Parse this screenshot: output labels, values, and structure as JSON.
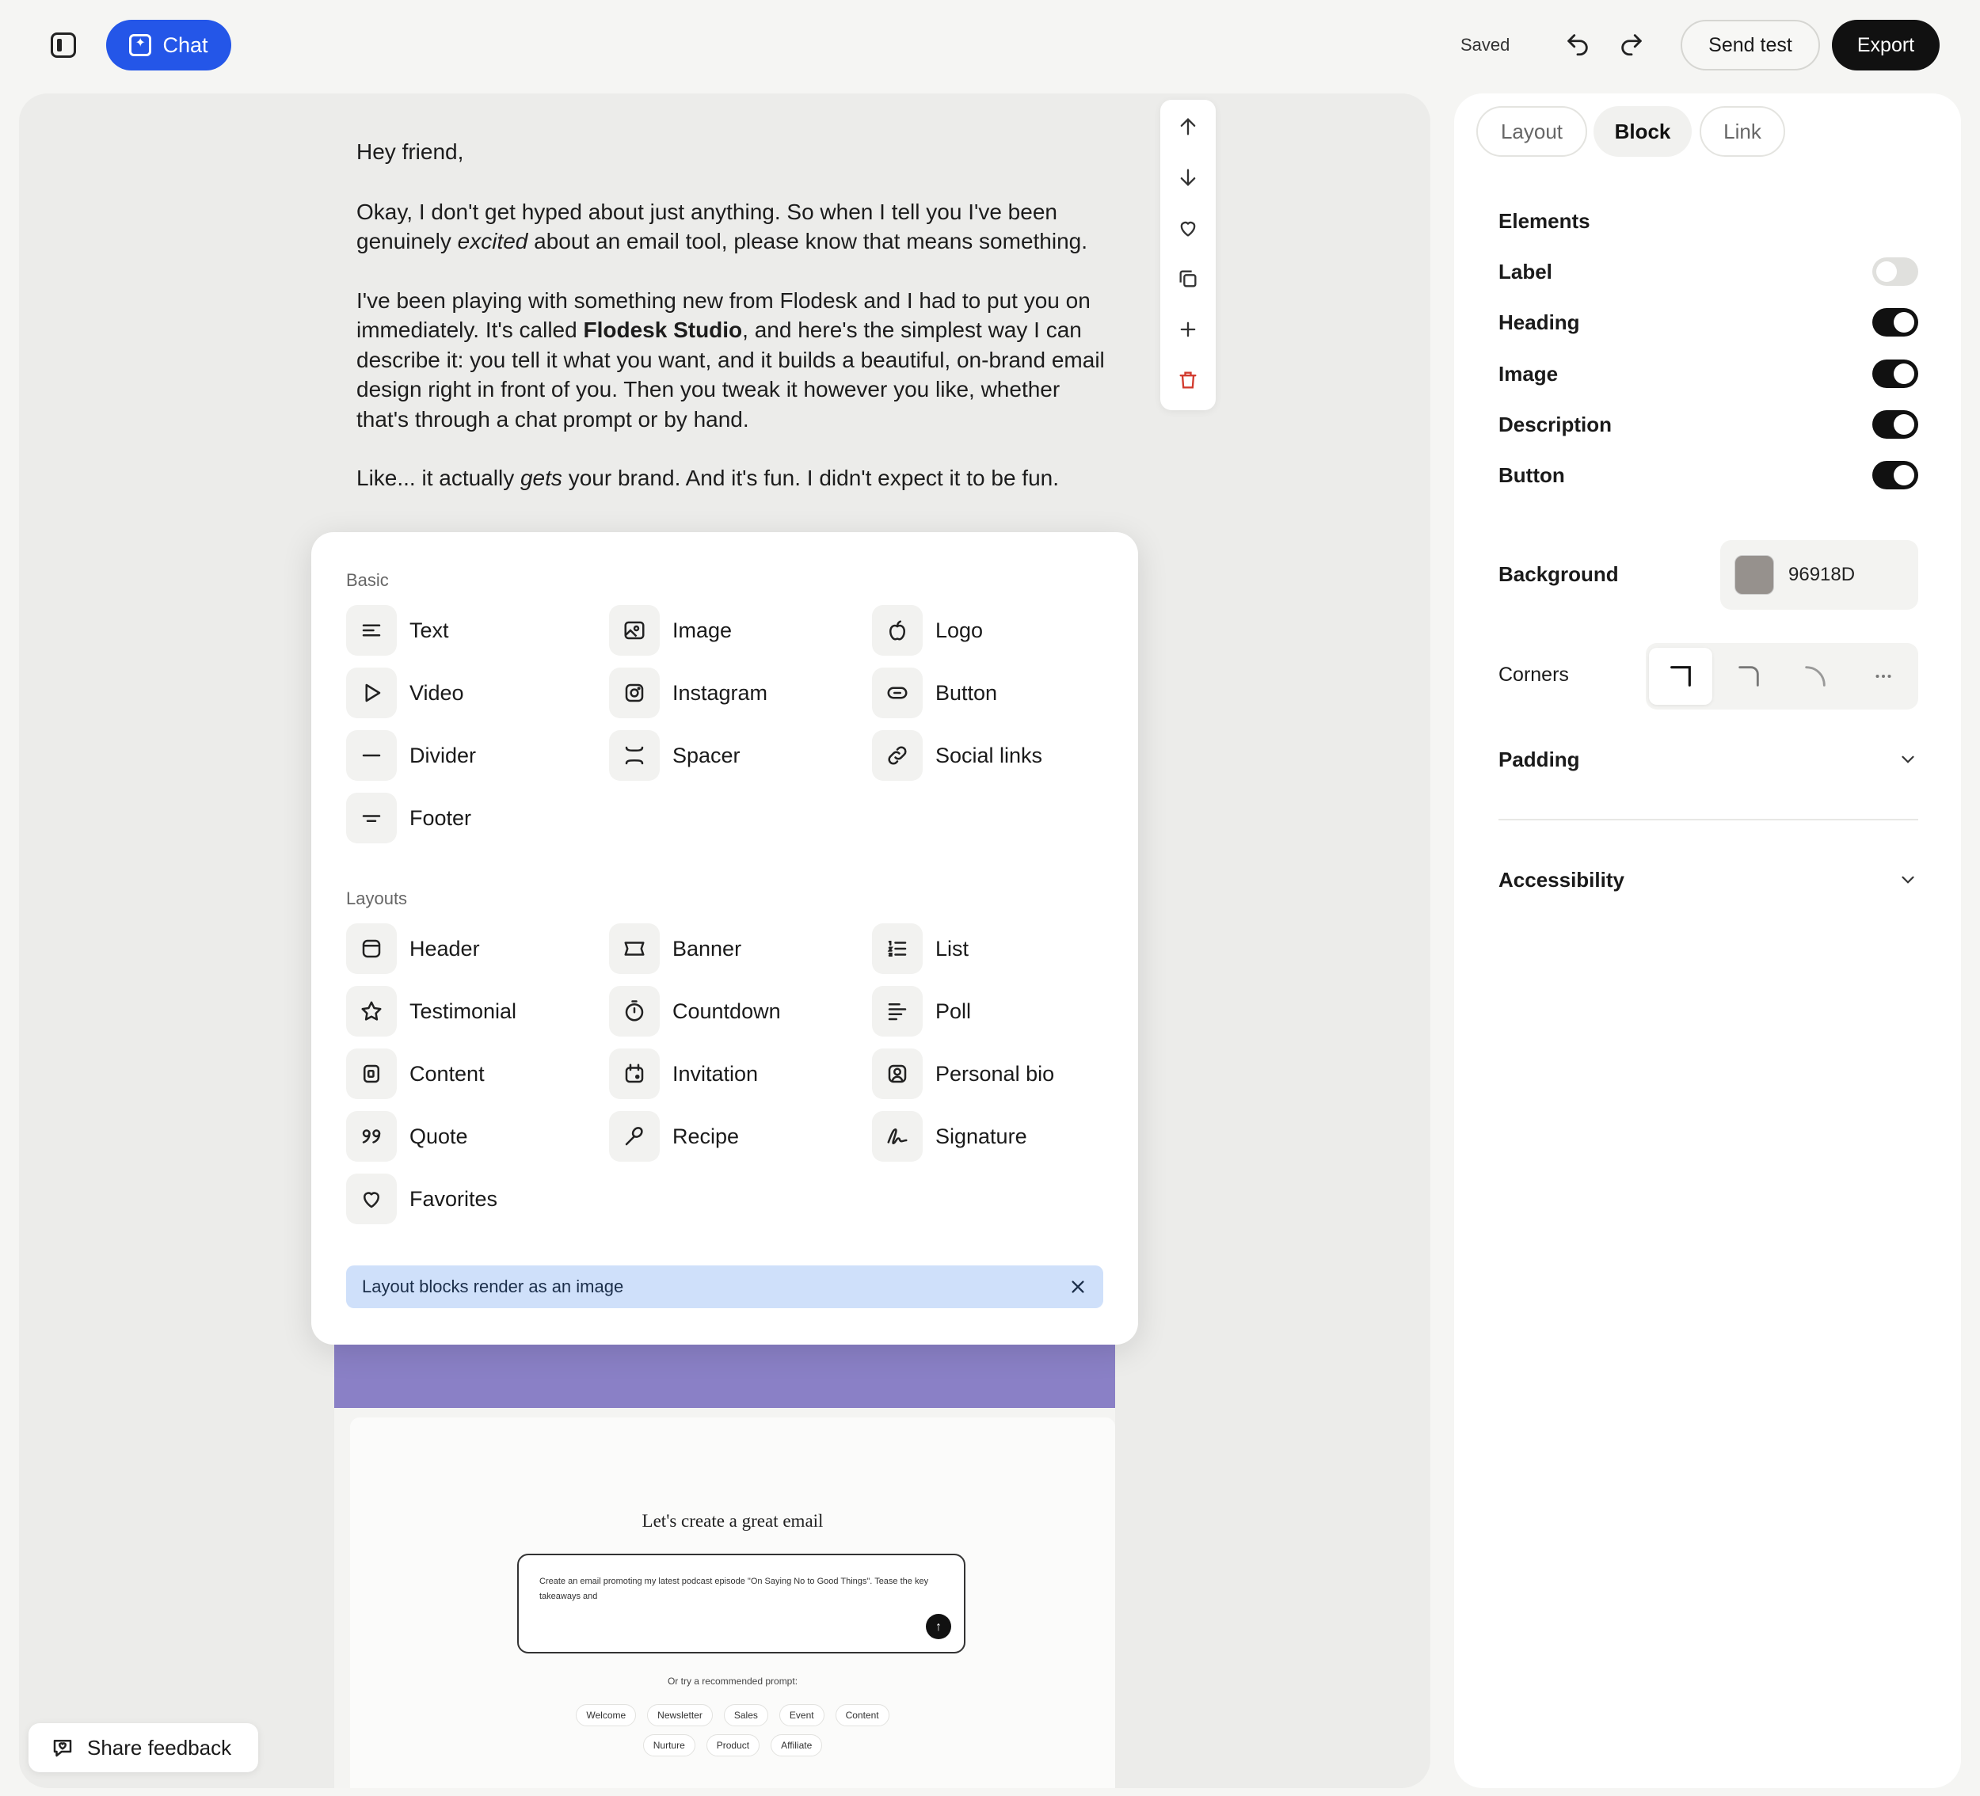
{
  "toolbar": {
    "chat_label": "Chat",
    "saved_label": "Saved",
    "send_test_label": "Send test",
    "export_label": "Export"
  },
  "email": {
    "greeting": "Hey friend,",
    "p1_a": "Okay, I don't get hyped about just anything. So when I tell you I've been genuinely ",
    "p1_em": "excited",
    "p1_b": " about an email tool, please know that means something.",
    "p2_a": "I've been playing with something new from Flodesk and I had to put you on immediately. It's called ",
    "p2_strong": "Flodesk Studio",
    "p2_b": ", and here's the simplest way I can describe it: you tell it what you want, and it builds a beautiful, on-brand email design right in front of you. Then you tweak it however you like, whether that's through a chat prompt or by hand.",
    "p3_a": "Like... it actually ",
    "p3_em": "gets",
    "p3_b": " your brand. And it's fun. I didn't expect it to be fun."
  },
  "preview": {
    "title": "Let's create a great email",
    "prompt_text": "Create an email promoting my latest podcast episode \"On Saying No to Good Things\". Tease the key takeaways and",
    "sub": "Or try a recommended prompt:",
    "chips_row1": [
      "Welcome",
      "Newsletter",
      "Sales",
      "Event",
      "Content"
    ],
    "chips_row2": [
      "Nurture",
      "Product",
      "Affiliate"
    ]
  },
  "picker": {
    "basic_title": "Basic",
    "layouts_title": "Layouts",
    "basic_items": [
      "Text",
      "Image",
      "Logo",
      "Video",
      "Instagram",
      "Button",
      "Divider",
      "Spacer",
      "Social links",
      "Footer"
    ],
    "layout_items": [
      "Header",
      "Banner",
      "List",
      "Testimonial",
      "Countdown",
      "Poll",
      "Content",
      "Invitation",
      "Personal bio",
      "Quote",
      "Recipe",
      "Signature",
      "Favorites"
    ],
    "notice": "Layout blocks render as an image"
  },
  "panel": {
    "tabs": [
      "Layout",
      "Block",
      "Link"
    ],
    "elements_title": "Elements",
    "toggles": [
      {
        "label": "Label",
        "on": false
      },
      {
        "label": "Heading",
        "on": true
      },
      {
        "label": "Image",
        "on": true
      },
      {
        "label": "Description",
        "on": true
      },
      {
        "label": "Button",
        "on": true
      }
    ],
    "background_label": "Background",
    "background_value": "96918D",
    "background_color": "#96918D",
    "corners_label": "Corners",
    "padding_label": "Padding",
    "accessibility_label": "Accessibility"
  },
  "feedback_label": "Share feedback",
  "colors": {
    "accent": "#2456e8",
    "purple_strip": "#8a80c6",
    "notice_bg": "#cfe0fa"
  }
}
